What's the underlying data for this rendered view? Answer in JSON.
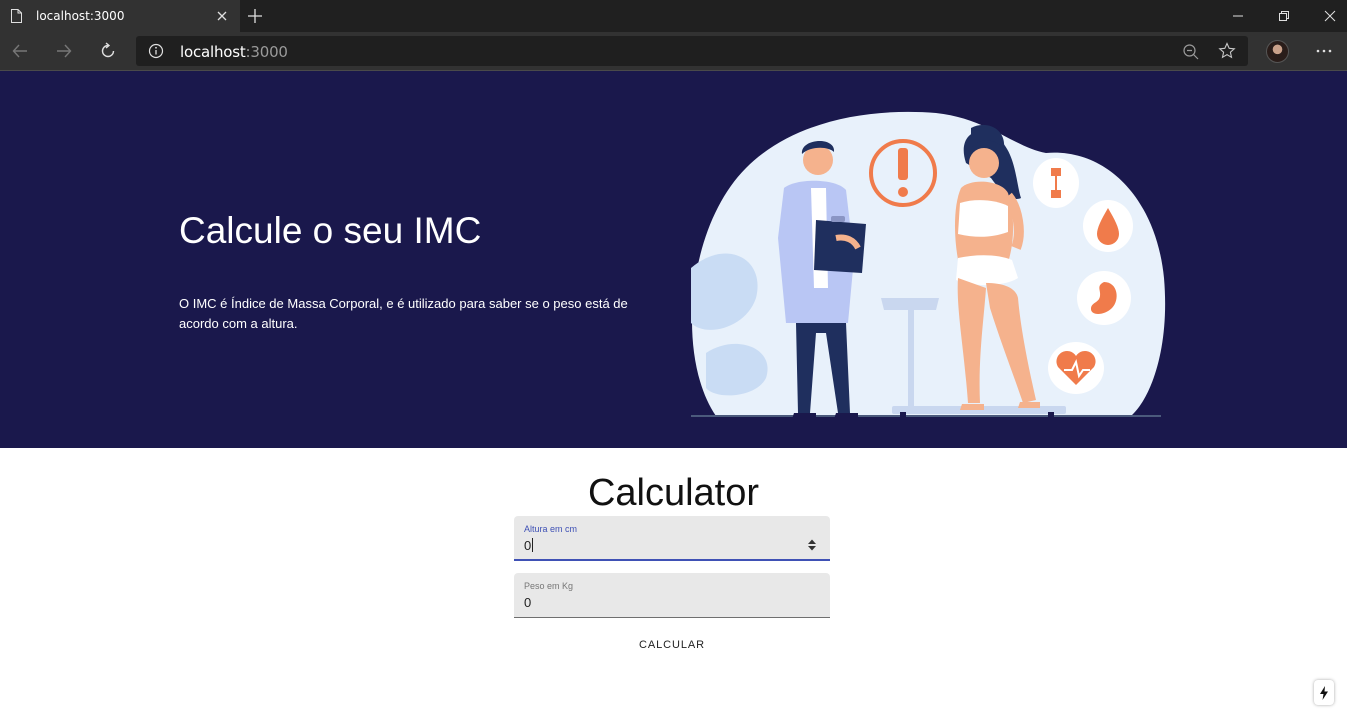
{
  "browser": {
    "tab_title": "localhost:3000",
    "url_host": "localhost",
    "url_port": ":3000"
  },
  "hero": {
    "title": "Calcule o seu IMC",
    "description": "O IMC é Índice de Massa Corporal, e é utilizado para saber se o peso está de acordo com a altura."
  },
  "calculator": {
    "title": "Calculator",
    "altura": {
      "label": "Altura em cm",
      "value": "0"
    },
    "peso": {
      "label": "Peso em Kg",
      "value": "0"
    },
    "button_label": "CALCULAR"
  },
  "colors": {
    "hero_background": "#1a184c",
    "accent_orange": "#f07b4b",
    "field_focus": "#3f51b5"
  }
}
